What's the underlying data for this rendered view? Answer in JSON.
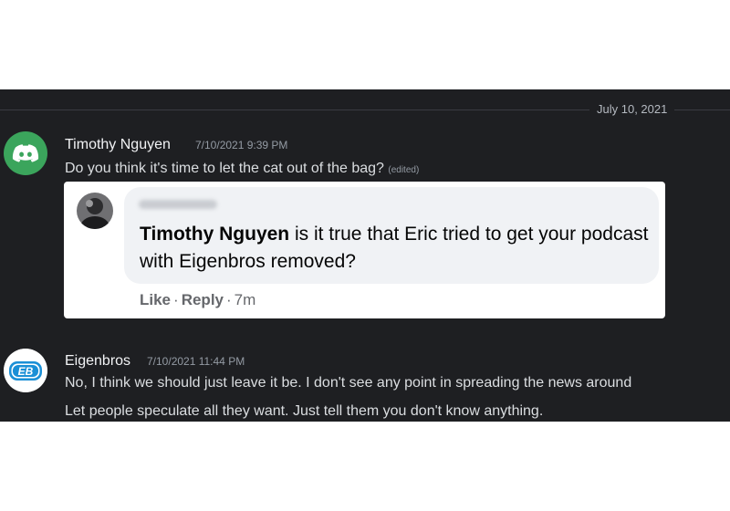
{
  "date_divider": "July 10, 2021",
  "messages": [
    {
      "author": "Timothy Nguyen",
      "timestamp": "7/10/2021 9:39 PM",
      "text": "Do you think it's time to let the cat out of the bag?",
      "edited_label": "(edited)",
      "avatar_icon": "discord-logo-icon",
      "avatar_color": "#3ba55c"
    },
    {
      "author": "Eigenbros",
      "timestamp": "7/10/2021 11:44 PM",
      "lines": [
        "No, I think we should just leave it be. I don't see any point in spreading the news around",
        "Let people speculate all they want. Just tell them you don't know anything."
      ],
      "avatar_icon": "eigenbros-logo-icon",
      "avatar_text": "EB"
    }
  ],
  "embed": {
    "comment_author": "Timothy Nguyen",
    "comment_text": " is it true that Eric tried to get your podcast with Eigenbros removed?",
    "actions": {
      "like": "Like",
      "separator": "·",
      "reply": "Reply",
      "age": "7m"
    }
  },
  "colors": {
    "background": "#1e1f22",
    "username": "#f2f3f5",
    "message_text": "#dbdee1",
    "muted": "#949ba4",
    "embed_bubble": "#f0f2f5"
  }
}
